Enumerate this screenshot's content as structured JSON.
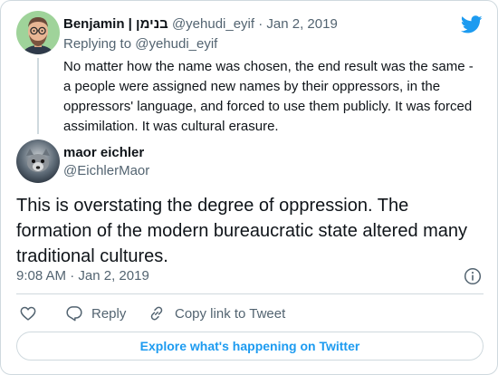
{
  "parent_tweet": {
    "author_name": "Benjamin | בנימן",
    "handle": "@yehudi_eyif",
    "separator": "·",
    "date": "Jan 2, 2019",
    "replying_to_prefix": "Replying to",
    "replying_to_handle": "@yehudi_eyif",
    "text": "No matter how the name was chosen, the end result was the same - a people were assigned new names by their oppressors, in the oppressors' language, and forced to use them publicly. It was forced assimilation. It was cultural erasure."
  },
  "main_tweet": {
    "author_name": "maor eichler",
    "handle": "@EichlerMaor",
    "text": "This is overstating the degree of oppression. The formation of the modern bureaucratic state altered many traditional cultures.",
    "time": "9:08 AM",
    "separator": "·",
    "date": "Jan 2, 2019"
  },
  "actions": {
    "reply_label": "Reply",
    "copy_link_label": "Copy link to Tweet"
  },
  "explore_button_label": "Explore what's happening on Twitter",
  "colors": {
    "brand_blue": "#1d9bf0",
    "text_primary": "#0f1419",
    "text_secondary": "#536471",
    "border": "#cfd9de"
  },
  "icons": [
    "twitter-bird-icon",
    "info-icon",
    "heart-icon",
    "reply-icon",
    "link-icon"
  ]
}
